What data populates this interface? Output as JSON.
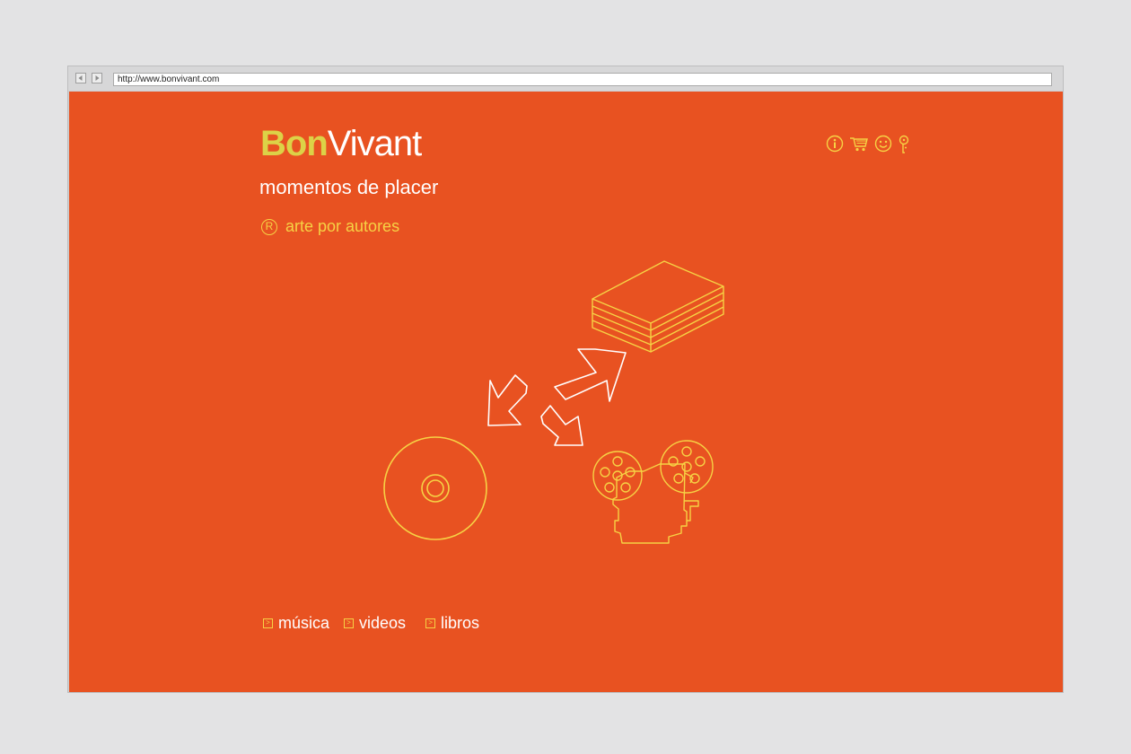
{
  "browser": {
    "url": "http://www.bonvivant.com",
    "back_icon": "back-arrow-icon",
    "forward_icon": "forward-arrow-icon"
  },
  "brand": {
    "name_bold": "Bon",
    "name_light": "Vivant",
    "tagline": "momentos de placer"
  },
  "feature": {
    "icon": "registered-r-icon",
    "label": "arte por autores"
  },
  "top_icons": [
    "info-icon",
    "cart-icon",
    "smiley-icon",
    "key-icon"
  ],
  "nav": {
    "items": [
      {
        "label": "música",
        "marker": ">"
      },
      {
        "label": "videos",
        "marker": ">"
      },
      {
        "label": "libros",
        "marker": ">"
      }
    ]
  },
  "illustrations": [
    "books-stack-icon",
    "cd-disc-icon",
    "film-projector-icon"
  ],
  "colors": {
    "background": "#e85221",
    "accent_yellow": "#f6d244",
    "brand_yellow": "#dcd247",
    "text_white": "#ffffff"
  }
}
